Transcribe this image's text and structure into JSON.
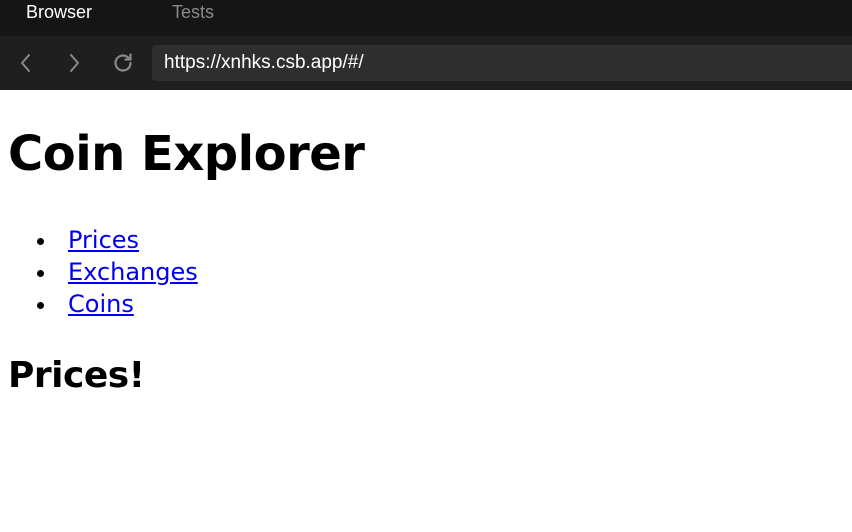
{
  "browser": {
    "tabs": [
      {
        "label": "Browser",
        "active": true
      },
      {
        "label": "Tests",
        "active": false
      }
    ],
    "nav": {
      "back_icon": "chevron-left-icon",
      "forward_icon": "chevron-right-icon",
      "reload_icon": "reload-icon"
    },
    "url": "https://xnhks.csb.app/#/"
  },
  "page": {
    "title": "Coin Explorer",
    "nav_links": [
      {
        "label": "Prices"
      },
      {
        "label": "Exchanges"
      },
      {
        "label": "Coins"
      }
    ],
    "heading": "Prices!"
  },
  "colors": {
    "chrome_bg": "#151515",
    "navbar_bg": "#1f1f1f",
    "urlbar_bg": "#2e2e2e",
    "link": "#0000ee"
  }
}
